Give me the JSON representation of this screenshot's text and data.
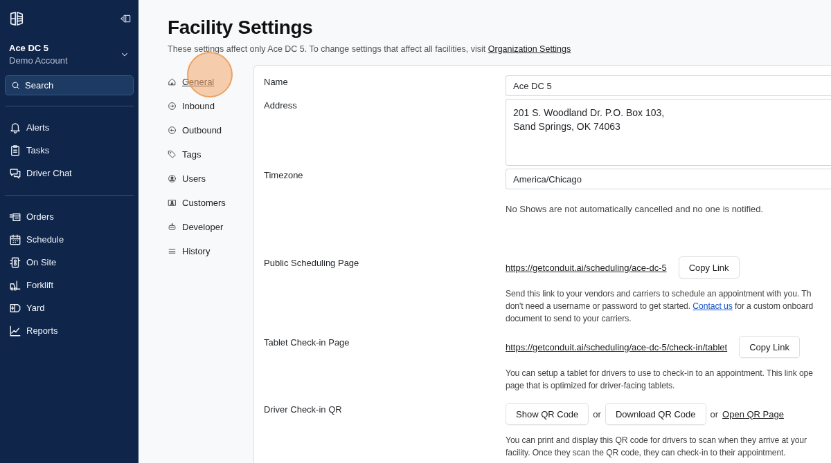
{
  "sidebar": {
    "account": {
      "name": "Ace DC 5",
      "subtitle": "Demo Account"
    },
    "search": {
      "placeholder": "Search"
    },
    "groups": [
      [
        {
          "label": "Alerts"
        },
        {
          "label": "Tasks"
        },
        {
          "label": "Driver Chat"
        }
      ],
      [
        {
          "label": "Orders"
        },
        {
          "label": "Schedule"
        },
        {
          "label": "On Site"
        },
        {
          "label": "Forklift"
        },
        {
          "label": "Yard"
        },
        {
          "label": "Reports"
        }
      ]
    ]
  },
  "page": {
    "title": "Facility Settings",
    "subtitle": "These settings affect only Ace DC 5. To change settings that affect all facilities, visit ",
    "subtitle_link": "Organization Settings"
  },
  "settings_nav": [
    {
      "label": "General",
      "selected": true
    },
    {
      "label": "Inbound",
      "selected": false
    },
    {
      "label": "Outbound",
      "selected": false
    },
    {
      "label": "Tags",
      "selected": false
    },
    {
      "label": "Users",
      "selected": false
    },
    {
      "label": "Customers",
      "selected": false
    },
    {
      "label": "Developer",
      "selected": false
    },
    {
      "label": "History",
      "selected": false
    }
  ],
  "click_marker": {
    "shown": true
  },
  "rows": [
    {
      "kind": "field",
      "label": "Name",
      "value": "Ace DC 5"
    },
    {
      "kind": "textarea",
      "label": "Address",
      "value": "201 S. Woodland Dr. P.O. Box 103,\nSand Springs, OK 74063"
    },
    {
      "kind": "select",
      "label": "Timezone",
      "value": "America/Chicago"
    },
    {
      "kind": "note",
      "text": "No Shows are not automatically cancelled and no one is notified."
    },
    {
      "kind": "link",
      "label": "Public Scheduling Page",
      "url": "https://getconduit.ai/scheduling/ace-dc-5",
      "button": "Copy Link",
      "description": [
        [
          {
            "text": "Send this link to your vendors and carriers to schedule an appointment with you. Th"
          }
        ],
        [
          {
            "text": "don't need a username or password to get started. "
          },
          {
            "text": "Contact us",
            "kind": "link"
          },
          {
            "text": " for a custom onboard"
          }
        ],
        [
          {
            "text": "document to send to your carriers."
          }
        ]
      ]
    },
    {
      "kind": "link",
      "label": "Tablet Check-in Page",
      "url": "https://getconduit.ai/scheduling/ace-dc-5/check-in/tablet",
      "button": "Copy Link",
      "description": [
        [
          {
            "text": "You can setup a tablet for drivers to use to check-in to an appointment. This link ope"
          }
        ],
        [
          {
            "text": "page that is optimized for driver-facing tablets."
          }
        ]
      ]
    },
    {
      "kind": "qr",
      "label": "Driver Check-in QR",
      "buttons": [
        "Show QR Code",
        "Download QR Code"
      ],
      "separators": [
        "or",
        "or"
      ],
      "link": "Open QR Page",
      "description": [
        [
          {
            "text": "You can print and display this QR code for drivers to scan when they arrive at your"
          }
        ],
        [
          {
            "text": "facility. Once they scan the QR code, they can check-in to their appointment."
          }
        ]
      ]
    }
  ]
}
